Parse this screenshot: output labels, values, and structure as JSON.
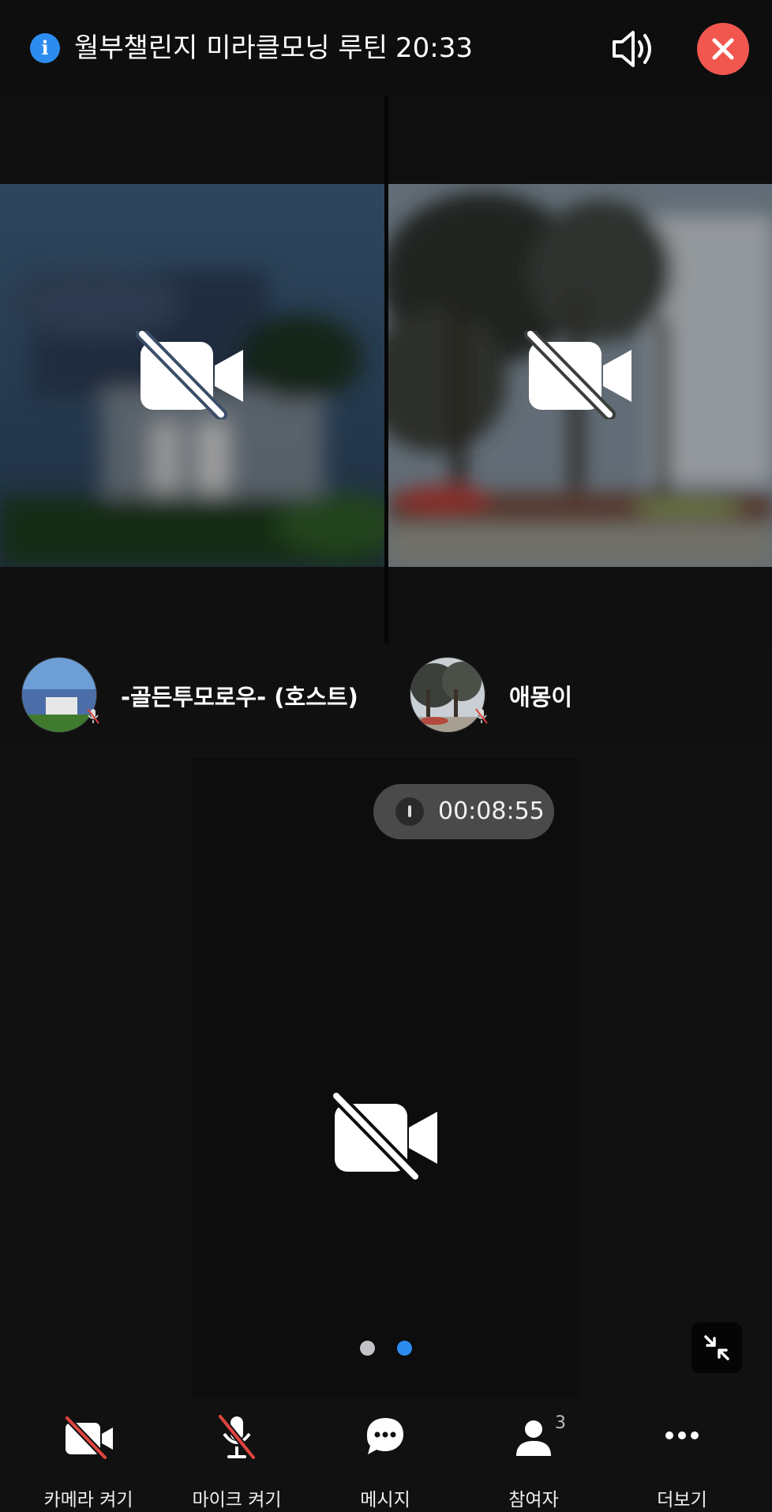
{
  "header": {
    "title": "월부챌린지 미라클모닝 루틴",
    "time": "20:33",
    "icons": {
      "info": "info-icon",
      "speaker": "speaker-icon",
      "close": "close-icon"
    }
  },
  "participants": [
    {
      "name": "-골든투모로우- (호스트)",
      "camera": "off",
      "mic": "muted"
    },
    {
      "name": "애몽이",
      "camera": "off",
      "mic": "muted"
    }
  ],
  "self_view": {
    "camera": "off"
  },
  "timer": {
    "elapsed": "00:08:55"
  },
  "pagination": {
    "pages": 2,
    "current": 2
  },
  "bottom_nav": [
    {
      "label": "카메라 켜기",
      "icon": "camera-off-icon"
    },
    {
      "label": "마이크 켜기",
      "icon": "mic-off-icon"
    },
    {
      "label": "메시지",
      "icon": "chat-icon"
    },
    {
      "label": "참여자",
      "icon": "person-icon",
      "badge": "3"
    },
    {
      "label": "더보기",
      "icon": "more-icon"
    }
  ],
  "colors": {
    "background": "#111111",
    "accent": "#2d8cf0",
    "close": "#f2574f",
    "muted": "#e0453e"
  }
}
